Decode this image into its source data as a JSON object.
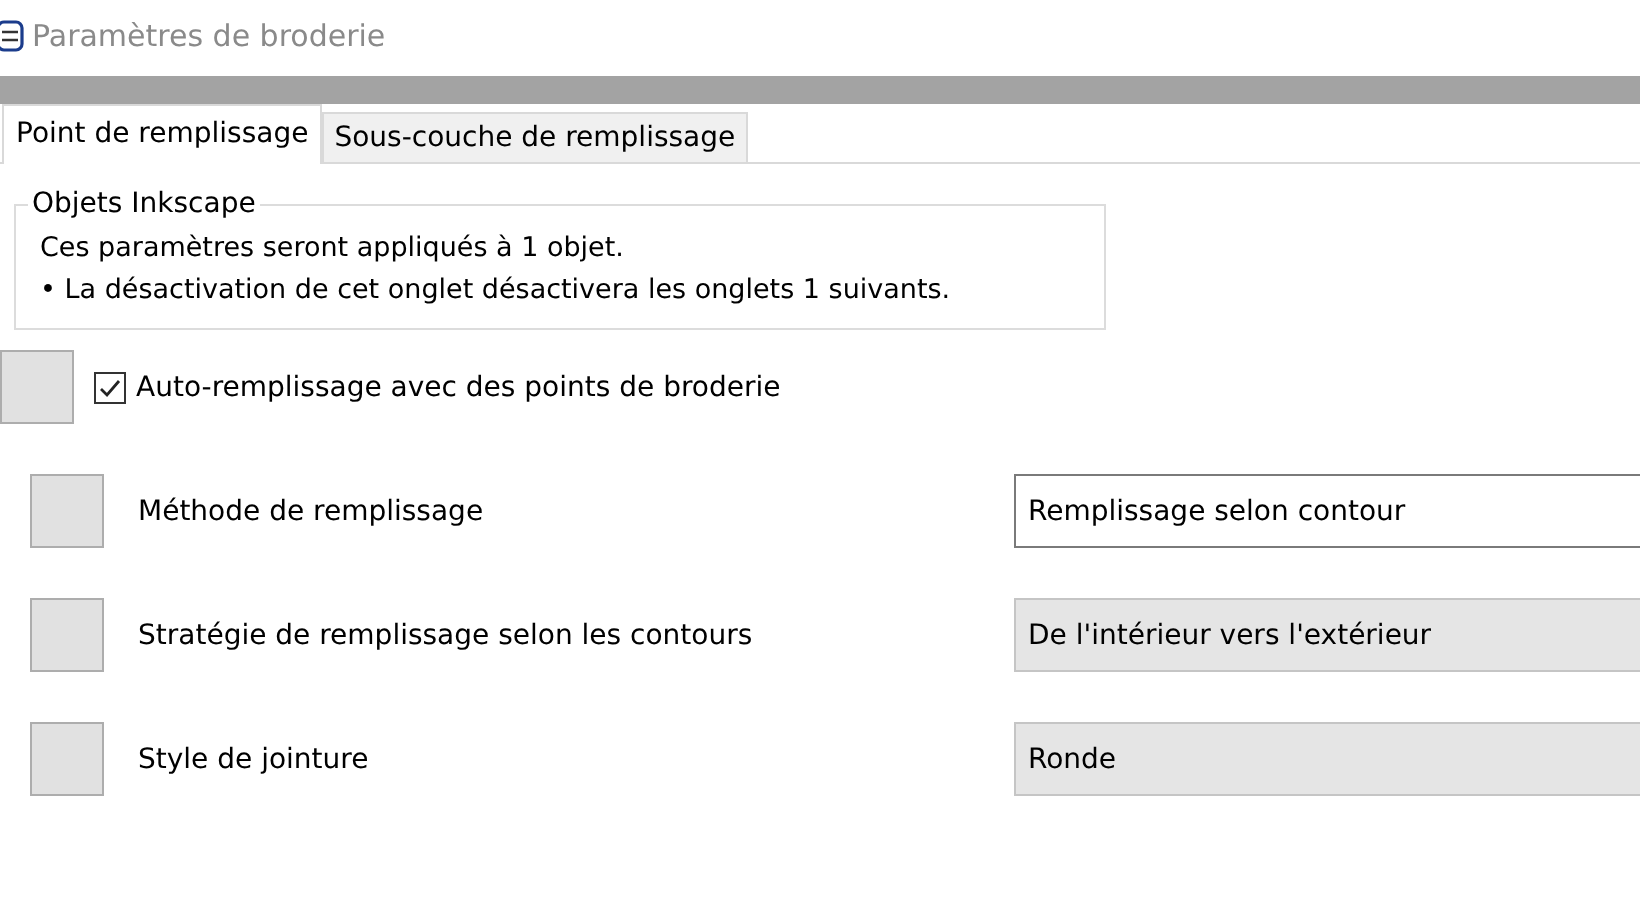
{
  "window": {
    "title": "Paramètres de broderie"
  },
  "tabs": [
    {
      "label": "Point de remplissage",
      "selected": true
    },
    {
      "label": "Sous-couche de remplissage",
      "selected": false
    }
  ],
  "group": {
    "title": "Objets Inkscape",
    "lines": [
      "Ces paramètres seront appliqués à 1 objet.",
      "• La désactivation de cet onglet désactivera les onglets 1 suivants."
    ]
  },
  "auto_fill": {
    "label": "Auto-remplissage avec des points de broderie",
    "checked": true
  },
  "params": [
    {
      "label": "Méthode de remplissage",
      "value": "Remplissage selon contour",
      "kind": "text"
    },
    {
      "label": "Stratégie de remplissage selon les contours",
      "value": "De l'intérieur vers l'extérieur",
      "kind": "combo"
    },
    {
      "label": "Style de jointure",
      "value": "Ronde",
      "kind": "combo"
    }
  ]
}
